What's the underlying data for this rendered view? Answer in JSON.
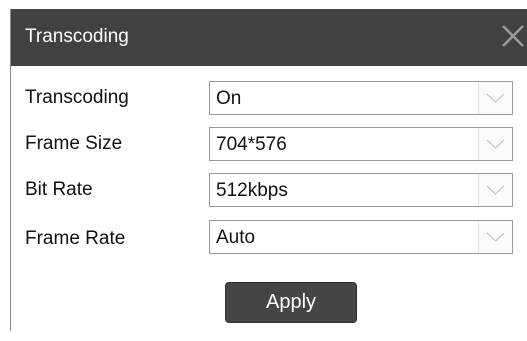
{
  "dialog": {
    "title": "Transcoding",
    "close_icon": "close-icon",
    "fields": [
      {
        "label": "Transcoding",
        "value": "On"
      },
      {
        "label": "Frame Size",
        "value": "704*576"
      },
      {
        "label": "Bit Rate",
        "value": "512kbps"
      },
      {
        "label": "Frame Rate",
        "value": "Auto"
      }
    ],
    "apply_label": "Apply"
  },
  "colors": {
    "titlebar": "#414141",
    "button": "#454545",
    "border": "#9a9a9a"
  }
}
